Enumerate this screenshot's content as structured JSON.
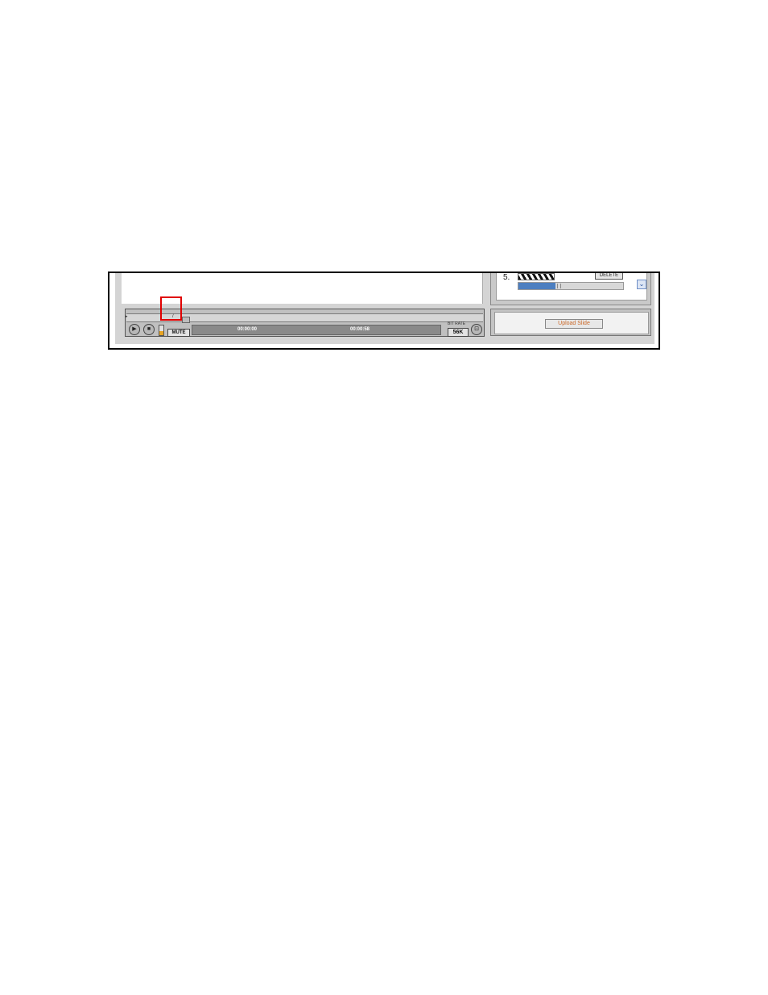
{
  "slides": {
    "current_number": "5.",
    "delete_label": "DELETE"
  },
  "upload": {
    "button_label": "Upload Slide"
  },
  "player": {
    "elapsed": "00:00:00",
    "total": "00:00:58",
    "mute_label": "MUTE",
    "speed_value": "56K",
    "speed_caption": "BIT RATE",
    "play_glyph": "▶",
    "stop_glyph": "■",
    "fullscreen_glyph": "⊡",
    "volume_level": 0.4,
    "ruler_marker": "/"
  },
  "colors": {
    "highlight": "#e00000",
    "upload_text": "#cc6a2a",
    "scroll_thumb": "#4d7fc0"
  }
}
